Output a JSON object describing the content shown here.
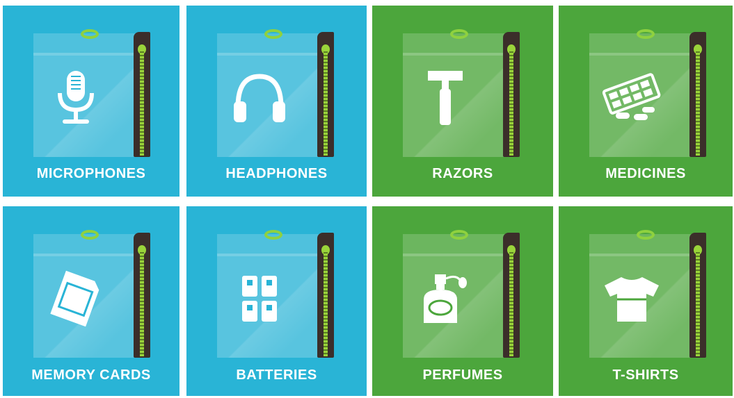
{
  "tiles": [
    {
      "label": "MICROPHONES",
      "color": "#29b4d6",
      "icon": "microphone-icon"
    },
    {
      "label": "HEADPHONES",
      "color": "#29b4d6",
      "icon": "headphones-icon"
    },
    {
      "label": "RAZORS",
      "color": "#4ca63c",
      "icon": "razor-icon"
    },
    {
      "label": "MEDICINES",
      "color": "#4ca63c",
      "icon": "pills-icon"
    },
    {
      "label": "MEMORY CARDS",
      "color": "#29b4d6",
      "icon": "memory-card-icon"
    },
    {
      "label": "BATTERIES",
      "color": "#29b4d6",
      "icon": "batteries-icon"
    },
    {
      "label": "PERFUMES",
      "color": "#4ca63c",
      "icon": "perfume-icon"
    },
    {
      "label": "T-SHIRTS",
      "color": "#4ca63c",
      "icon": "tshirt-icon"
    }
  ]
}
